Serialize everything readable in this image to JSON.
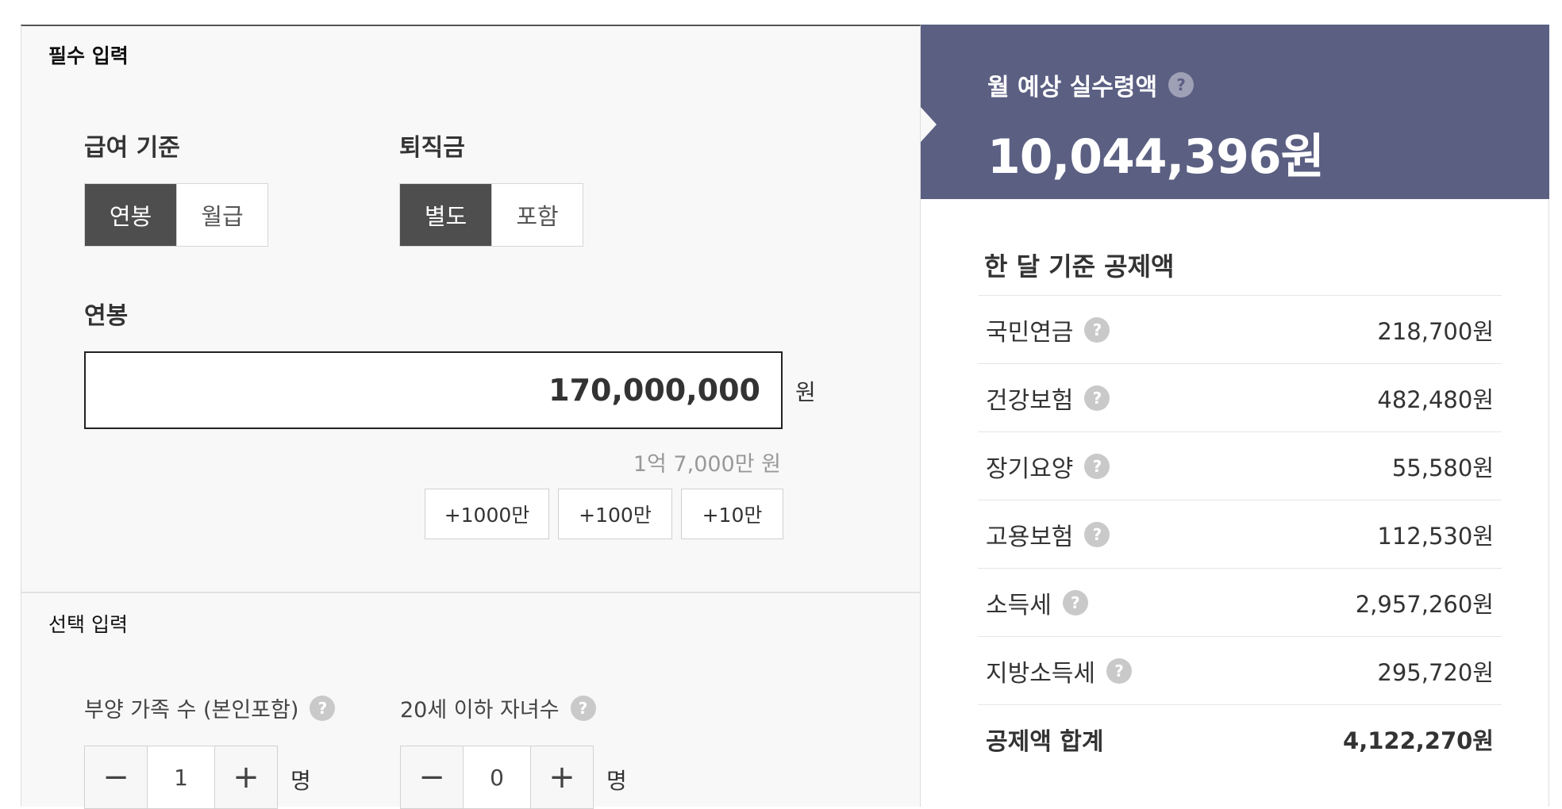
{
  "required": {
    "title": "필수 입력",
    "pay_basis": {
      "label": "급여 기준",
      "options": [
        "연봉",
        "월급"
      ],
      "selected": "연봉"
    },
    "severance": {
      "label": "퇴직금",
      "options": [
        "별도",
        "포함"
      ],
      "selected": "별도"
    },
    "salary": {
      "label": "연봉",
      "value": "170,000,000",
      "unit": "원",
      "korean": "1억 7,000만 원"
    },
    "add_buttons": [
      "+1000만",
      "+100만",
      "+10만"
    ]
  },
  "optional": {
    "title": "선택 입력",
    "dependents": {
      "label": "부양 가족 수 (본인포함)",
      "value": "1",
      "unit": "명"
    },
    "children": {
      "label": "20세 이하 자녀수",
      "value": "0",
      "unit": "명"
    },
    "minus": "−",
    "plus": "+"
  },
  "help_glyph": "?",
  "result": {
    "label": "월 예상 실수령액",
    "value": "10,044,396원",
    "deductions_title": "한 달 기준 공제액",
    "deductions": [
      {
        "name": "국민연금",
        "value": "218,700원"
      },
      {
        "name": "건강보험",
        "value": "482,480원"
      },
      {
        "name": "장기요양",
        "value": "55,580원"
      },
      {
        "name": "고용보험",
        "value": "112,530원"
      },
      {
        "name": "소득세",
        "value": "2,957,260원"
      },
      {
        "name": "지방소득세",
        "value": "295,720원"
      }
    ],
    "total": {
      "name": "공제액 합계",
      "value": "4,122,270원"
    }
  },
  "colors": {
    "header_bg": "#5b5f82",
    "active_button": "#4e4e4e",
    "panel_bg": "#f8f8f8"
  }
}
